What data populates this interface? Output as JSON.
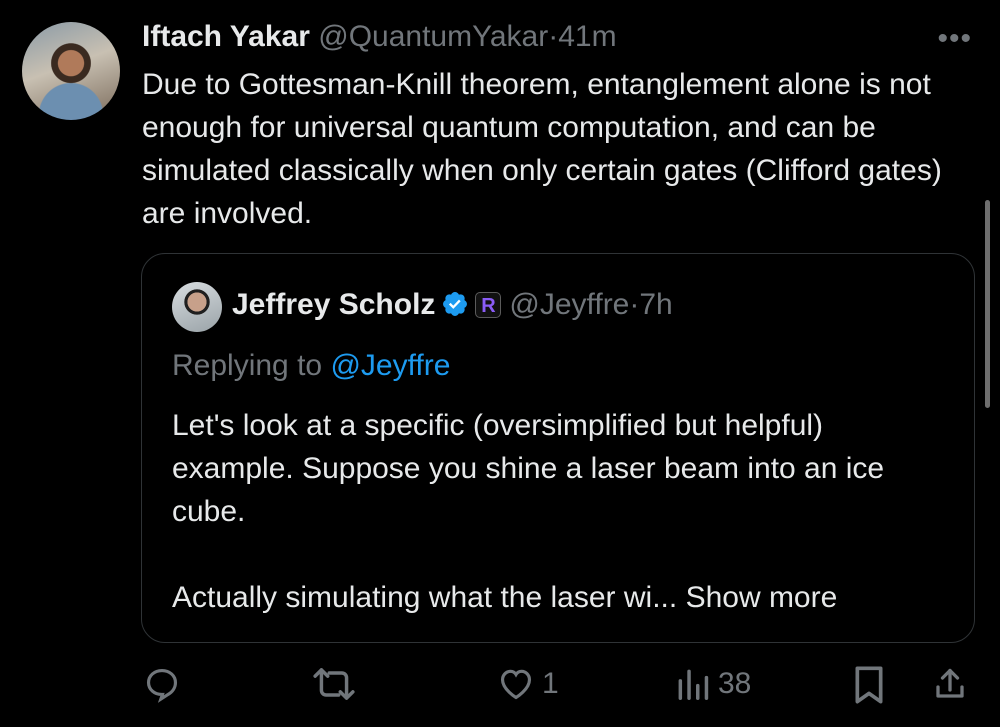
{
  "tweet": {
    "author_name": "Iftach Yakar",
    "author_handle": "@QuantumYakar",
    "separator": "·",
    "time": "41m",
    "more": "•••",
    "text": "Due to Gottesman-Knill theorem, entanglement alone is not enough for universal quantum computation, and can be simulated classically when only certain gates (Clifford gates) are involved."
  },
  "quote": {
    "author_name": "Jeffrey Scholz",
    "badge_letter": "R",
    "author_handle": "@Jeyffre",
    "separator": "·",
    "time": "7h",
    "replying_prefix": "Replying to",
    "replying_handle": "@Jeyffre",
    "text_line1": "Let's look at a specific (oversimplified but helpful) example. Suppose you shine a laser beam into an ice cube.",
    "text_line2": "Actually simulating what the laser wi...",
    "show_more": "Show more"
  },
  "actions": {
    "reply_count": "",
    "retweet_count": "",
    "like_count": "1",
    "views_count": "38"
  },
  "colors": {
    "background": "#000000",
    "text": "#e7e9ea",
    "secondary": "#71767b",
    "accent": "#1d9bf0"
  }
}
